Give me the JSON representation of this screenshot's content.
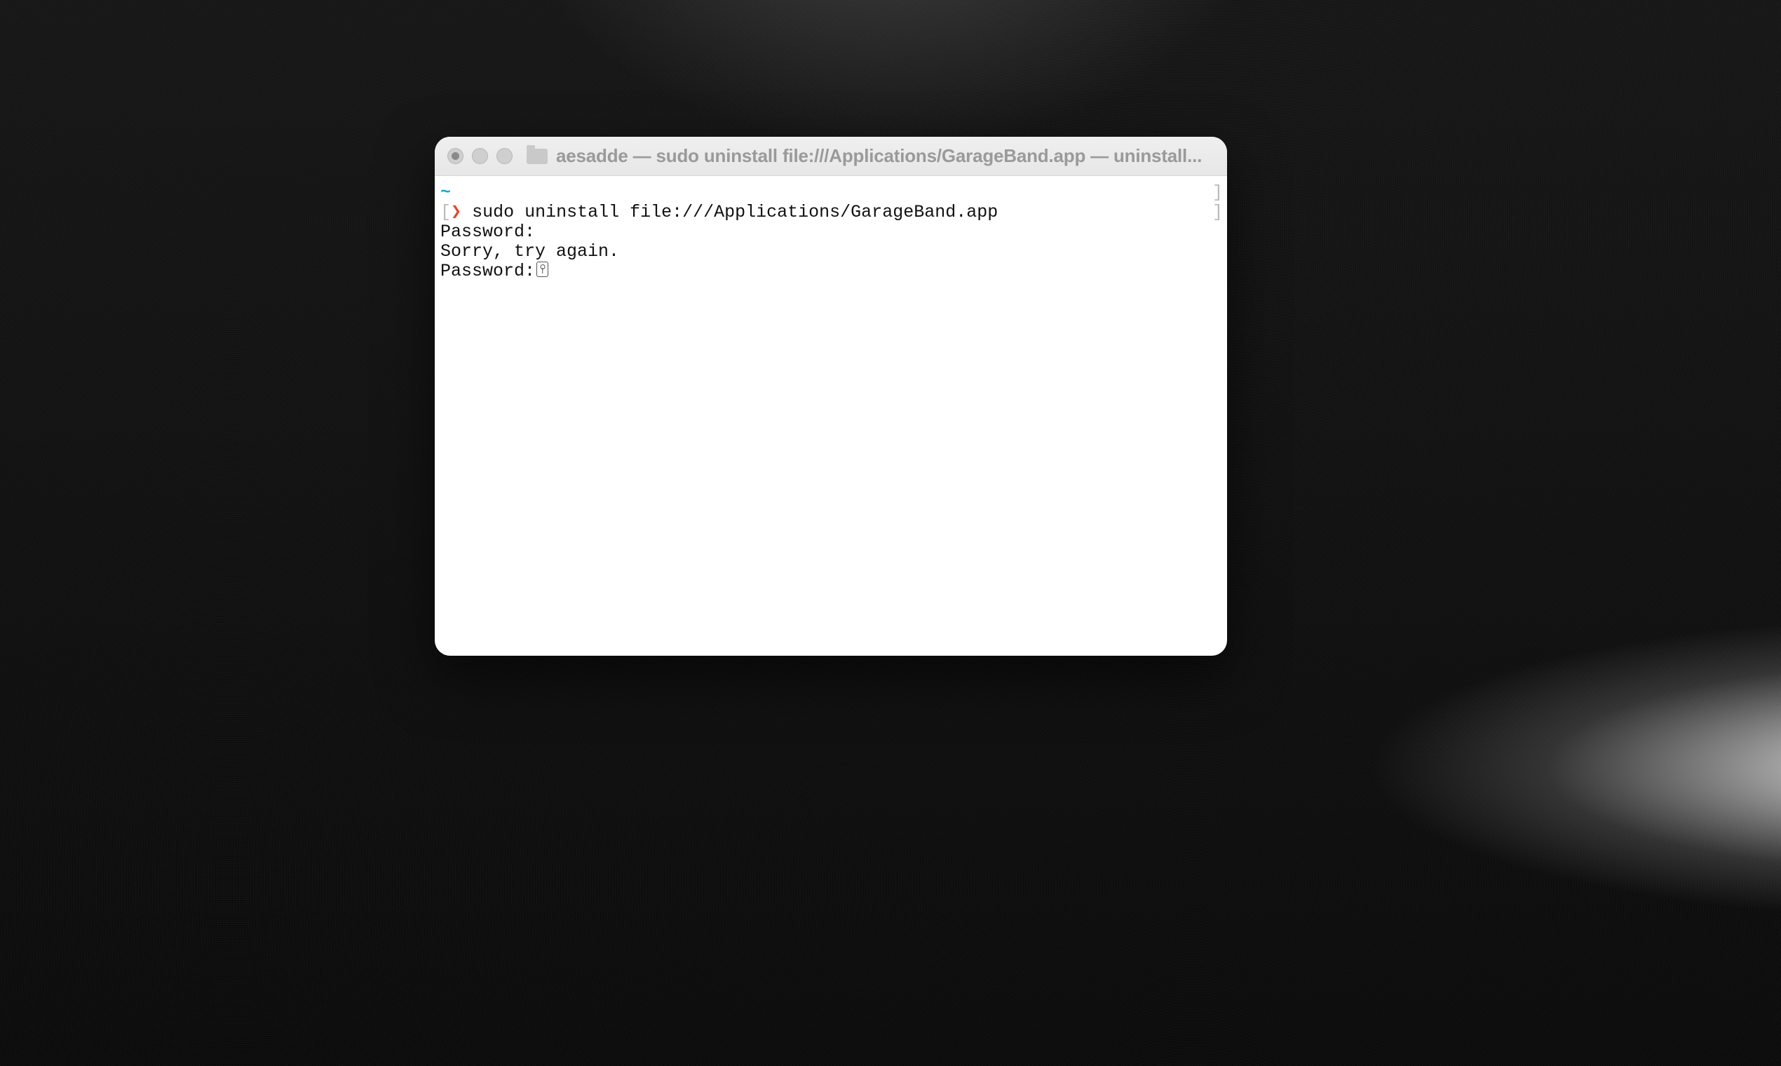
{
  "window": {
    "title": "aesadde — sudo uninstall file:///Applications/GarageBand.app — uninstall..."
  },
  "terminal": {
    "cwd_symbol": "~",
    "left_bracket": "[",
    "prompt_chevron": "❯",
    "right_bracket_line1": "]",
    "right_bracket_line2": "]",
    "command": "sudo uninstall file:///Applications/GarageBand.app",
    "line_password1": "Password:",
    "line_sorry": "Sorry, try again.",
    "line_password2": "Password:"
  }
}
